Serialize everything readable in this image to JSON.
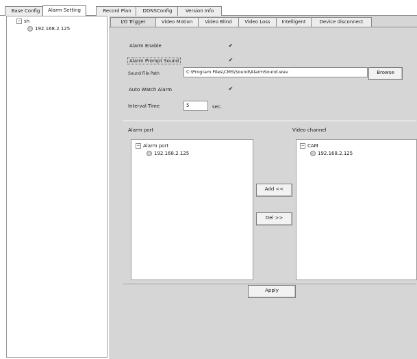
{
  "top_tabs": [
    "Base Config",
    "Alarm Setting",
    "Record Plan",
    "DDNSConfig",
    "Version Info"
  ],
  "sidebar": {
    "root_label": "sh",
    "device_label": "192.168.2.125"
  },
  "sub_tabs": [
    "I/O Trigger",
    "Video Motion",
    "Video Blind",
    "Video Loss",
    "Intelligent",
    "Device disconnect"
  ],
  "settings": {
    "alarm_enable_label": "Alarm Enable",
    "alarm_enable_checked": true,
    "prompt_sound_label": "Alarm Prompt Sound",
    "prompt_sound_checked": true,
    "sound_file_label": "Sound File Path",
    "sound_file_value": "C:\\Program Files\\CMS\\Sound\\AlarmSound.wav",
    "browse_label": "Browse",
    "auto_watch_label": "Auto Watch Alarm",
    "auto_watch_checked": true,
    "interval_label": "Interval Time",
    "interval_value": "5",
    "interval_unit": "sec."
  },
  "alarm_port": {
    "title": "Alarm port",
    "root": "Alarm port",
    "child": "192.168.2.125"
  },
  "video_channel": {
    "title": "Video channel",
    "root": "CAM",
    "child": "192.168.2.125"
  },
  "buttons": {
    "add": "Add <<",
    "del": "Del >>",
    "apply": "Apply"
  },
  "check_glyph": "✔"
}
